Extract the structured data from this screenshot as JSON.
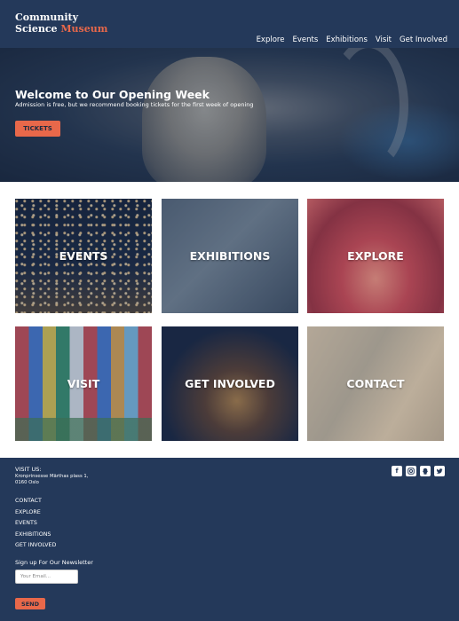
{
  "header": {
    "logo_line1": "Community",
    "logo_line2a": "Science ",
    "logo_line2b": "Museum",
    "nav": [
      "Explore",
      "Events",
      "Exhibitions",
      "Visit",
      "Get Involved"
    ]
  },
  "hero": {
    "title": "Welcome to Our Opening Week",
    "subtitle": "Admission is free, but we recommend booking tickets for the first week of opening",
    "tickets_label": "TICKETS"
  },
  "tiles": [
    "EVENTS",
    "EXHIBITIONS",
    "EXPLORE",
    "VISIT",
    "GET INVOLVED",
    "CONTACT"
  ],
  "footer": {
    "visit_heading": "VISIT US:",
    "address_line1": "Kronprinsesse Märthas plass 1,",
    "address_line2": "0160 Oslo",
    "links": [
      "CONTACT",
      "EXPLORE",
      "EVENTS",
      "EXHIBITIONS",
      "GET INVOLVED"
    ],
    "newsletter_heading": "Sign up For Our Newsletter",
    "email_placeholder": "Your Email...",
    "send_label": "SEND",
    "socials": [
      "facebook-icon",
      "instagram-icon",
      "snapchat-icon",
      "twitter-icon"
    ]
  },
  "colors": {
    "navy": "#24395a",
    "accent": "#e8684a"
  }
}
